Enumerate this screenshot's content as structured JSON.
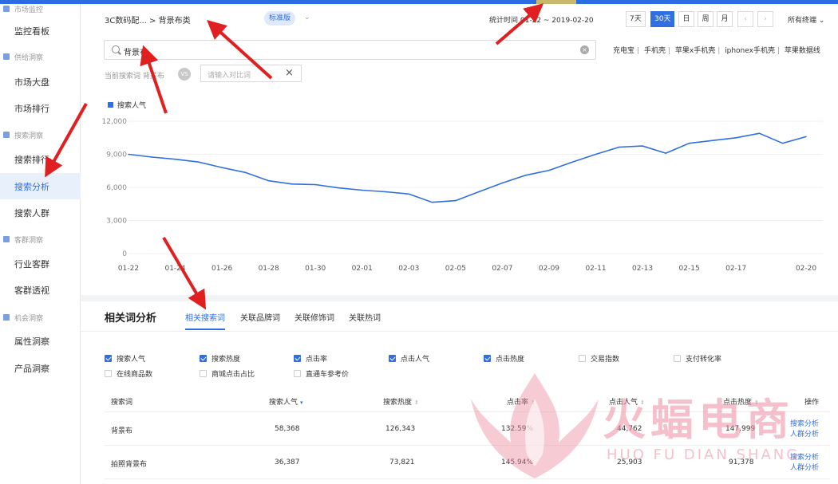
{
  "sidebar": {
    "groups": [
      {
        "label": "市场监控",
        "top": -4
      },
      {
        "label": "供给洞察",
        "top": 61
      },
      {
        "label": "搜索洞察",
        "top": 159
      },
      {
        "label": "客群洞察",
        "top": 290
      },
      {
        "label": "机会洞察",
        "top": 388
      }
    ],
    "items": [
      {
        "label": "监控看板"
      },
      {
        "label": "市场大盘"
      },
      {
        "label": "市场排行"
      },
      {
        "label": "搜索排行"
      },
      {
        "label": "搜索分析"
      },
      {
        "label": "搜索人群"
      },
      {
        "label": "行业客群"
      },
      {
        "label": "客群透视"
      },
      {
        "label": "属性洞察"
      },
      {
        "label": "产品洞察"
      }
    ]
  },
  "header": {
    "breadcrumb": "3C数码配... > 背景布类",
    "edition": "标准版",
    "stat_label": "统计时间",
    "date_range": "01-22 ~ 2019-02-20",
    "range_buttons": [
      "7天",
      "30天",
      "日",
      "周",
      "月"
    ],
    "active_range": "30天",
    "prev": "‹",
    "next": "›",
    "terminal": "所有终端"
  },
  "search": {
    "value": "背景布",
    "clear": "×",
    "quick_links": [
      "充电宝",
      "手机壳",
      "苹果x手机壳",
      "iphonex手机壳",
      "苹果数据线"
    ],
    "current_label": "当前搜索词 背景布",
    "vs": "VS",
    "compare_placeholder": "请输入对比词",
    "compare_close": "×"
  },
  "chart_data": {
    "type": "line",
    "legend": [
      "搜索人气"
    ],
    "x_labels": [
      "01-22",
      "01-24",
      "01-26",
      "01-28",
      "01-30",
      "02-01",
      "02-03",
      "02-05",
      "02-07",
      "02-09",
      "02-11",
      "02-13",
      "02-15",
      "02-17",
      "02-20"
    ],
    "y_ticks": [
      "12,000",
      "9,000",
      "6,000",
      "3,000",
      "0"
    ],
    "ylim": [
      0,
      12000
    ],
    "series": [
      {
        "name": "搜索人气",
        "color": "#2f6fe0",
        "x": [
          "01-22",
          "01-23",
          "01-24",
          "01-25",
          "01-26",
          "01-27",
          "01-28",
          "01-29",
          "01-30",
          "01-31",
          "02-01",
          "02-02",
          "02-03",
          "02-04",
          "02-05",
          "02-06",
          "02-07",
          "02-08",
          "02-09",
          "02-10",
          "02-11",
          "02-12",
          "02-13",
          "02-14",
          "02-15",
          "02-16",
          "02-17",
          "02-18",
          "02-19",
          "02-20"
        ],
        "values": [
          9000,
          8750,
          8550,
          8300,
          7800,
          7350,
          6600,
          6300,
          6250,
          5950,
          5750,
          5600,
          5400,
          4650,
          4800,
          5600,
          6400,
          7100,
          7550,
          8300,
          9000,
          9650,
          9750,
          9100,
          10000,
          10250,
          10500,
          10900,
          10000,
          10600
        ]
      }
    ]
  },
  "related": {
    "title": "相关词分析",
    "tabs": [
      "相关搜索词",
      "关联品牌词",
      "关联修饰词",
      "关联热词"
    ],
    "active_tab": "相关搜索词",
    "metrics_row1": [
      {
        "label": "搜索人气",
        "checked": true
      },
      {
        "label": "搜索热度",
        "checked": true
      },
      {
        "label": "点击率",
        "checked": true
      },
      {
        "label": "点击人气",
        "checked": true
      },
      {
        "label": "点击热度",
        "checked": true
      },
      {
        "label": "交易指数",
        "checked": false
      },
      {
        "label": "支付转化率",
        "checked": false
      }
    ],
    "metrics_row2": [
      {
        "label": "在线商品数",
        "checked": false
      },
      {
        "label": "商城点击占比",
        "checked": false
      },
      {
        "label": "直通车参考价",
        "checked": false
      }
    ],
    "columns": [
      "搜索词",
      "搜索人气",
      "搜索热度",
      "点击率",
      "点击人气",
      "点击热度",
      "操作"
    ],
    "rows": [
      {
        "term": "背景布",
        "pop": "58,368",
        "heat": "126,343",
        "ctr": "132.59%",
        "click_pop": "44,762",
        "click_heat": "147,999",
        "action1": "搜索分析",
        "action2": "人群分析"
      },
      {
        "term": "拍照背景布",
        "pop": "36,387",
        "heat": "73,821",
        "ctr": "145.94%",
        "click_pop": "25,903",
        "click_heat": "91,378",
        "action1": "搜索分析",
        "action2": "人群分析"
      }
    ]
  },
  "watermark": {
    "text": "火蝠电商",
    "sub": "HUO FU DIAN SHANG"
  },
  "colors": {
    "accent": "#2f6fe0",
    "annotation_arrow": "#e02020",
    "watermark": "#ec8ca0"
  }
}
